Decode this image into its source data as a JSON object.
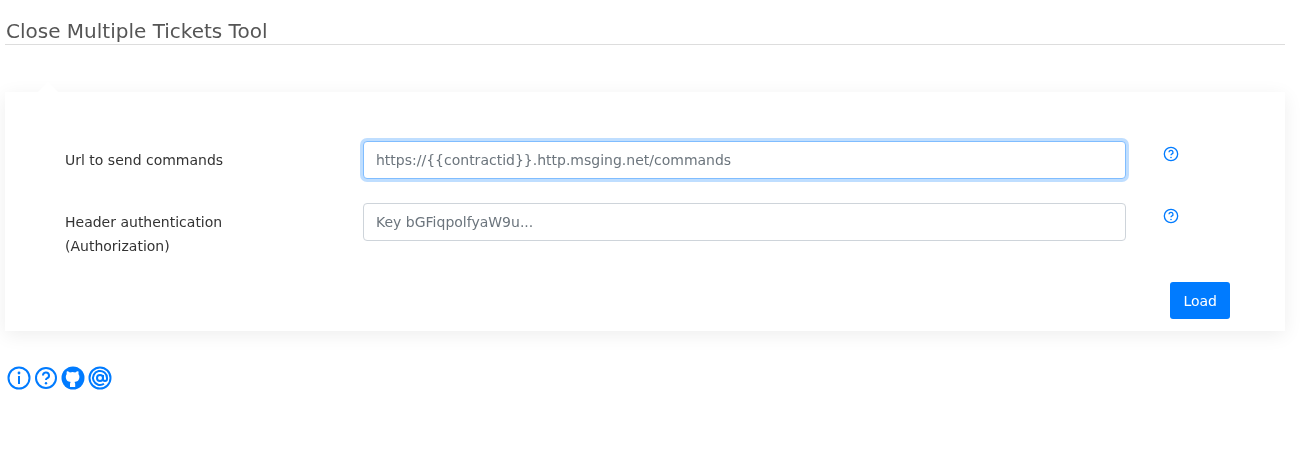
{
  "title": "Close Multiple Tickets Tool",
  "fields": [
    {
      "label": "Url to send commands",
      "placeholder": "https://{{contractid}}.http.msging.net/commands",
      "focused": true
    },
    {
      "label": "Header authentication (Authorization)",
      "placeholder": "Key bGFiqpolfyaW9u...",
      "focused": false
    }
  ],
  "button": "Load"
}
